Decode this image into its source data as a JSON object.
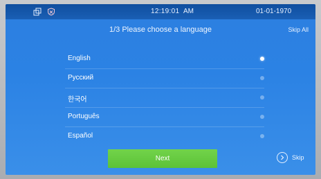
{
  "status_bar": {
    "time": "12:19:01",
    "ampm": "AM",
    "date": "01-01-1970",
    "icons": [
      "windows-icon",
      "shield-icon"
    ]
  },
  "header": {
    "title": "1/3 Please choose a language",
    "skip_all_label": "Skip All"
  },
  "languages": [
    {
      "label": "English",
      "selected": true
    },
    {
      "label": "Русский",
      "selected": false
    },
    {
      "label": "한국어",
      "selected": false
    },
    {
      "label": "Português",
      "selected": false
    },
    {
      "label": "Español",
      "selected": false
    }
  ],
  "footer": {
    "next_label": "Next",
    "skip_label": "Skip",
    "skip_icon": "chevron-right-circle-icon"
  },
  "colors": {
    "screen_bg": "#2b82e4",
    "status_bar_bg": "#1a5fb5",
    "next_button_bg": "#5cc238"
  }
}
